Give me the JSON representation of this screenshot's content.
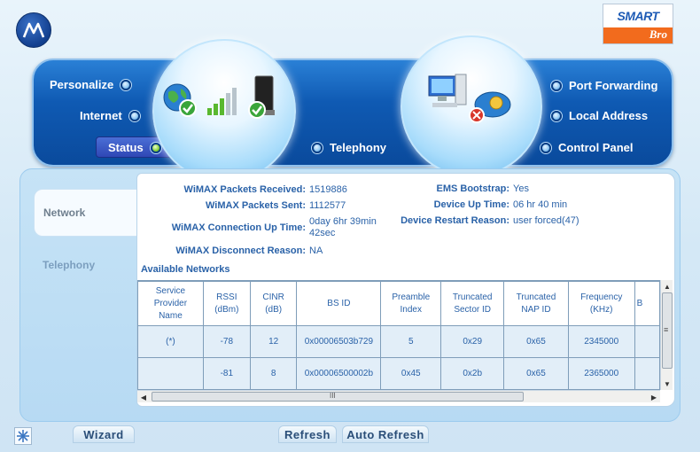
{
  "header": {
    "motorola_logo_icon": "motorola-batwing",
    "brand_logo": {
      "top": "SMART",
      "bottom": "Bro"
    }
  },
  "nav": {
    "left": {
      "personalize": "Personalize",
      "internet": "Internet",
      "status": "Status",
      "telephony": "Telephony"
    },
    "right": {
      "port_forwarding": "Port Forwarding",
      "local_address": "Local Address",
      "control_panel": "Control Panel"
    },
    "active": "Status"
  },
  "side_tabs": {
    "network": "Network",
    "telephony": "Telephony"
  },
  "info": {
    "packets_received_label": "WiMAX Packets Received:",
    "packets_received_value": "1519886",
    "packets_sent_label": "WiMAX Packets Sent:",
    "packets_sent_value": "1112577",
    "connection_up_label": "WiMAX Connection Up Time:",
    "connection_up_value_line1": "0day 6hr 39min",
    "connection_up_value_line2": "42sec",
    "disconnect_reason_label": "WiMAX Disconnect Reason:",
    "disconnect_reason_value": "NA",
    "ems_bootstrap_label": "EMS Bootstrap:",
    "ems_bootstrap_value": "Yes",
    "device_up_label": "Device Up Time:",
    "device_up_value": "06 hr 40 min",
    "restart_reason_label": "Device Restart Reason:",
    "restart_reason_value": "user forced(47)"
  },
  "networks": {
    "title": "Available Networks",
    "columns": [
      [
        "Service",
        "Provider",
        "Name"
      ],
      [
        "RSSI",
        "(dBm)"
      ],
      [
        "CINR",
        "(dB)"
      ],
      [
        "BS ID"
      ],
      [
        "Preamble",
        "Index"
      ],
      [
        "Truncated",
        "Sector ID"
      ],
      [
        "Truncated",
        "NAP ID"
      ],
      [
        "Frequency",
        "(KHz)"
      ],
      [
        "B"
      ]
    ],
    "rows": [
      [
        "(*)",
        "-78",
        "12",
        "0x00006503b729",
        "5",
        "0x29",
        "0x65",
        "2345000",
        ""
      ],
      [
        "",
        "-81",
        "8",
        "0x00006500002b",
        "0x45",
        "0x2b",
        "0x65",
        "2365000",
        ""
      ]
    ]
  },
  "scrollbar": {
    "grip_glyph": "≡",
    "h_grip_glyph": "III"
  },
  "buttons": {
    "wizard": "Wizard",
    "refresh": "Refresh",
    "auto_refresh": "Auto Refresh"
  }
}
